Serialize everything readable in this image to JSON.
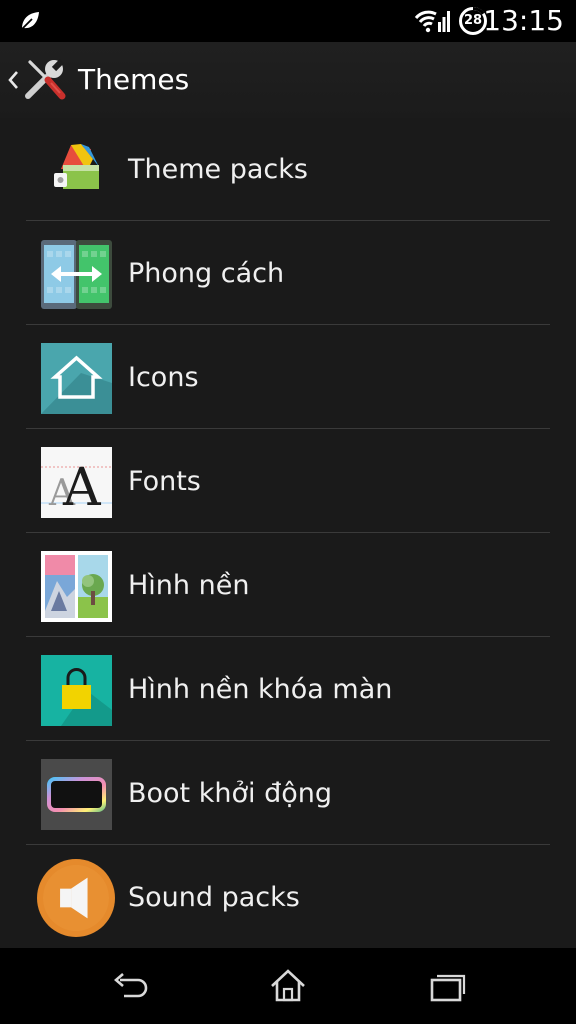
{
  "status_bar": {
    "battery_level": "28",
    "time": "13:15"
  },
  "header": {
    "title": "Themes"
  },
  "items": [
    {
      "label": "Theme packs",
      "icon": "theme-packs-icon"
    },
    {
      "label": "Phong cách",
      "icon": "style-icon"
    },
    {
      "label": "Icons",
      "icon": "home-icon"
    },
    {
      "label": "Fonts",
      "icon": "fonts-icon"
    },
    {
      "label": "Hình nền",
      "icon": "wallpaper-icon"
    },
    {
      "label": "Hình nền khóa màn",
      "icon": "lock-icon"
    },
    {
      "label": "Boot khởi động",
      "icon": "boot-animation-icon"
    },
    {
      "label": "Sound packs",
      "icon": "speaker-icon"
    }
  ],
  "colors": {
    "background": "#1a1a1a",
    "divider": "#3a3a3a",
    "teal": "#17b3a2",
    "orange": "#e58a2c"
  }
}
